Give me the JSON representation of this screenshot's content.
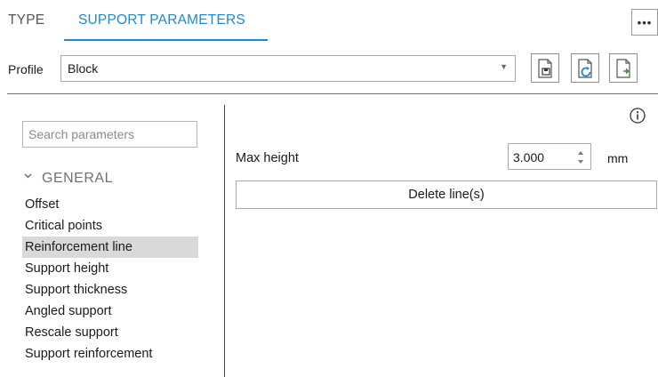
{
  "tabs": [
    {
      "label": "TYPE",
      "active": false
    },
    {
      "label": "SUPPORT PARAMETERS",
      "active": true
    }
  ],
  "more_button": {
    "icon": "ellipsis-icon",
    "label": "•••"
  },
  "profile": {
    "label": "Profile",
    "value": "Block",
    "actions": [
      {
        "icon": "document-save-icon"
      },
      {
        "icon": "document-refresh-icon"
      },
      {
        "icon": "document-export-icon"
      }
    ]
  },
  "search": {
    "placeholder": "Search parameters",
    "value": ""
  },
  "nav": {
    "group": "GENERAL",
    "items": [
      {
        "label": "Offset"
      },
      {
        "label": "Critical points"
      },
      {
        "label": "Reinforcement line",
        "selected": true
      },
      {
        "label": "Support height"
      },
      {
        "label": "Support thickness"
      },
      {
        "label": "Angled support"
      },
      {
        "label": "Rescale support"
      },
      {
        "label": "Support reinforcement"
      }
    ]
  },
  "params": {
    "info_icon": "info-icon",
    "max_height": {
      "label": "Max height",
      "value": "3.000",
      "unit": "mm"
    },
    "delete_button": "Delete line(s)"
  },
  "colors": {
    "accent": "#1e88d6",
    "selected_bg": "#d9d9d9",
    "divider": "#444444"
  }
}
